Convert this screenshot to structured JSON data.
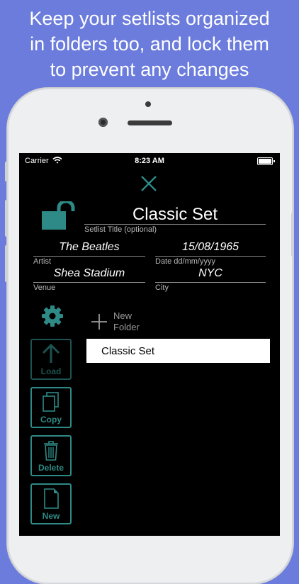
{
  "headline": {
    "line1": "Keep your setlists organized",
    "line2": "in folders too, and lock them",
    "line3": "to prevent any changes"
  },
  "status_bar": {
    "carrier": "Carrier",
    "time": "8:23 AM"
  },
  "setlist": {
    "title_value": "Classic Set",
    "title_label": "Setlist Title (optional)",
    "artist_value": "The Beatles",
    "artist_label": "Artist",
    "date_value": "15/08/1965",
    "date_label": "Date dd/mm/yyyy",
    "venue_value": "Shea Stadium",
    "venue_label": "Venue",
    "city_value": "NYC",
    "city_label": "City"
  },
  "folders": {
    "new_folder_line1": "New",
    "new_folder_line2": "Folder",
    "items": [
      {
        "label": "Classic Set"
      }
    ]
  },
  "toolbar": {
    "load_label": "Load",
    "copy_label": "Copy",
    "delete_label": "Delete",
    "new_label": "New"
  },
  "colors": {
    "background": "#6b7cdc",
    "accent": "#2e8a86",
    "accent_dim": "#1c5351",
    "screen": "#000000"
  },
  "icons": {
    "close": "close-icon",
    "lock": "unlocked-padlock-icon",
    "settings": "gear-icon",
    "new_folder": "plus-icon",
    "load": "arrow-up-icon",
    "copy": "copy-icon",
    "delete": "trash-icon",
    "new": "document-icon"
  }
}
